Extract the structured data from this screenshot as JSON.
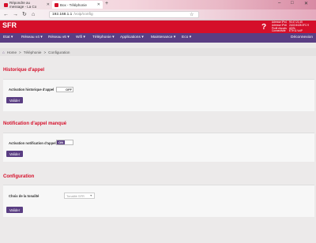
{
  "browser": {
    "tabs": [
      {
        "title": "Répondre au message - La Co"
      },
      {
        "title": "Box - Téléphonie"
      }
    ],
    "new_tab": "+",
    "window_controls": [
      "–",
      "□",
      "✕"
    ],
    "url": {
      "host": "192.168.1.1",
      "path": "/voip/config"
    },
    "nav": {
      "back": "←",
      "forward": "→",
      "reload": "↻",
      "home": "⌂"
    },
    "bookmark": "☆"
  },
  "header": {
    "logo": "SFR",
    "help": "?",
    "info": [
      {
        "k": "Adresse IPv4",
        "v": "90.47.21.45"
      },
      {
        "k": "Adresse IPv6",
        "v": "2A02:8428:3FC:9"
      },
      {
        "k": "Profil d'accès",
        "v": "ADSL"
      },
      {
        "k": "Connectivité",
        "v": "ETH & VoIP"
      }
    ]
  },
  "menu": {
    "items": [
      "Etat ▾",
      "Réseau v4 ▾",
      "Réseau v6 ▾",
      "Wifi ▾",
      "Téléphonie ▾",
      "Applications ▾",
      "Maintenance ▾",
      "Eco ▾"
    ],
    "logout": "Déconnexion"
  },
  "breadcrumb": {
    "home_icon": "⌂",
    "items": [
      "Home",
      "Téléphonie",
      "Configuration"
    ],
    "sep": ">"
  },
  "sections": {
    "history": {
      "title": "Historique d'appel",
      "label": "Activation historique d'appel",
      "toggle": "OFF",
      "button": "Valider"
    },
    "missed": {
      "title": "Notification d'appel manqué",
      "label": "Activation notification d'appel",
      "toggle": "ON",
      "button": "Valider"
    },
    "config": {
      "title": "Configuration",
      "label": "Choix de la tonalité",
      "select": "Tonalité SFR",
      "button": "Valider"
    }
  }
}
